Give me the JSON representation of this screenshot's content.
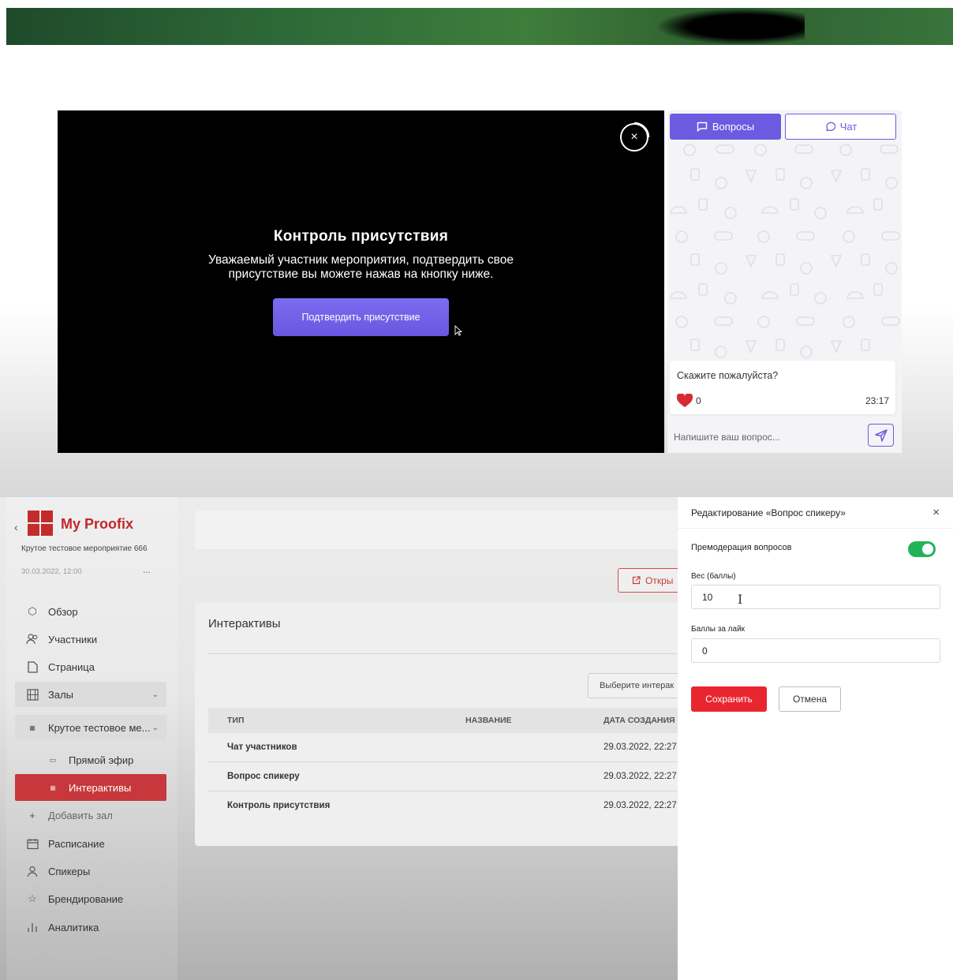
{
  "player": {
    "title": "Контроль присутствия",
    "text": "Уважаемый участник мероприятия, подтвердить свое присутствие вы можете нажав на кнопку ниже.",
    "confirm_label": "Подтвердить присутствие",
    "close_glyph": "×"
  },
  "chat": {
    "tab_questions": "Вопросы",
    "tab_chat": "Чат",
    "question_text": "Скажите пожалуйста?",
    "likes": "0",
    "time": "23:17",
    "input_placeholder": "Напишите ваш вопрос..."
  },
  "sidebar": {
    "brand": "My Proofix",
    "event_name": "Крутое тестовое мероприятие 666",
    "event_date": "30.03.2022, 12:00",
    "more": "...",
    "items": [
      {
        "label": "Обзор",
        "icon": "cube-icon"
      },
      {
        "label": "Участники",
        "icon": "users-icon"
      },
      {
        "label": "Страница",
        "icon": "page-icon"
      },
      {
        "label": "Залы",
        "icon": "film-icon"
      },
      {
        "label": "Крутое тестовое ме...",
        "icon": "grid-icon"
      },
      {
        "label": "Прямой эфир",
        "icon": "video-icon"
      },
      {
        "label": "Интерактивы",
        "icon": "grid-icon"
      },
      {
        "label": "Добавить зал",
        "icon": "plus-icon"
      },
      {
        "label": "Расписание",
        "icon": "calendar-icon"
      },
      {
        "label": "Спикеры",
        "icon": "person-icon"
      },
      {
        "label": "Брендирование",
        "icon": "star-icon"
      },
      {
        "label": "Аналитика",
        "icon": "bar-chart-icon"
      }
    ]
  },
  "main": {
    "open_label": "Откры",
    "card_title": "Интерактивы",
    "select_label": "Выберите интерак",
    "columns": [
      "ТИП",
      "НАЗВАНИЕ",
      "ДАТА СОЗДАНИЯ"
    ],
    "rows": [
      {
        "type": "Чат участников",
        "name": "",
        "date": "29.03.2022, 22:27"
      },
      {
        "type": "Вопрос спикеру",
        "name": "",
        "date": "29.03.2022, 22:27"
      },
      {
        "type": "Контроль присутствия",
        "name": "",
        "date": "29.03.2022, 22:27"
      }
    ]
  },
  "drawer": {
    "title": "Редактирование «Вопрос спикеру»",
    "close": "×",
    "premod_label": "Премодерация вопросов",
    "premod_on": true,
    "weight_label": "Вес (баллы)",
    "weight_value": "10",
    "like_label": "Баллы за лайк",
    "like_value": "0",
    "save_label": "Сохранить",
    "cancel_label": "Отмена"
  },
  "colors": {
    "accent_purple": "#6c5be0",
    "brand_red": "#c1272d",
    "save_red": "#e8262f",
    "toggle_green": "#22b35a"
  }
}
